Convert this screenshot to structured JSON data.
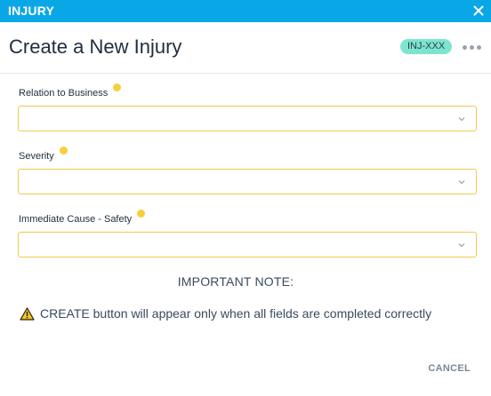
{
  "window": {
    "title": "INJURY"
  },
  "header": {
    "title": "Create a New Injury",
    "badge": "INJ-XXX"
  },
  "fields": [
    {
      "label": "Relation to Business",
      "value": ""
    },
    {
      "label": "Severity",
      "value": ""
    },
    {
      "label": "Immediate Cause - Safety",
      "value": ""
    }
  ],
  "note": {
    "title": "IMPORTANT NOTE:",
    "text": "CREATE button will appear only when all fields are completed correctly"
  },
  "footer": {
    "cancel_label": "CANCEL"
  },
  "colors": {
    "titlebar": "#0aa7e6",
    "badge": "#7de5cf",
    "field_border": "#f2c94c",
    "info_dot": "#f7cf3b",
    "warning": "#f5c518"
  },
  "icons": {
    "close": "close-icon",
    "more": "more-options-icon",
    "info": "info-dot-icon",
    "dropdown": "chevron-down-icon",
    "warning": "warning-icon"
  }
}
